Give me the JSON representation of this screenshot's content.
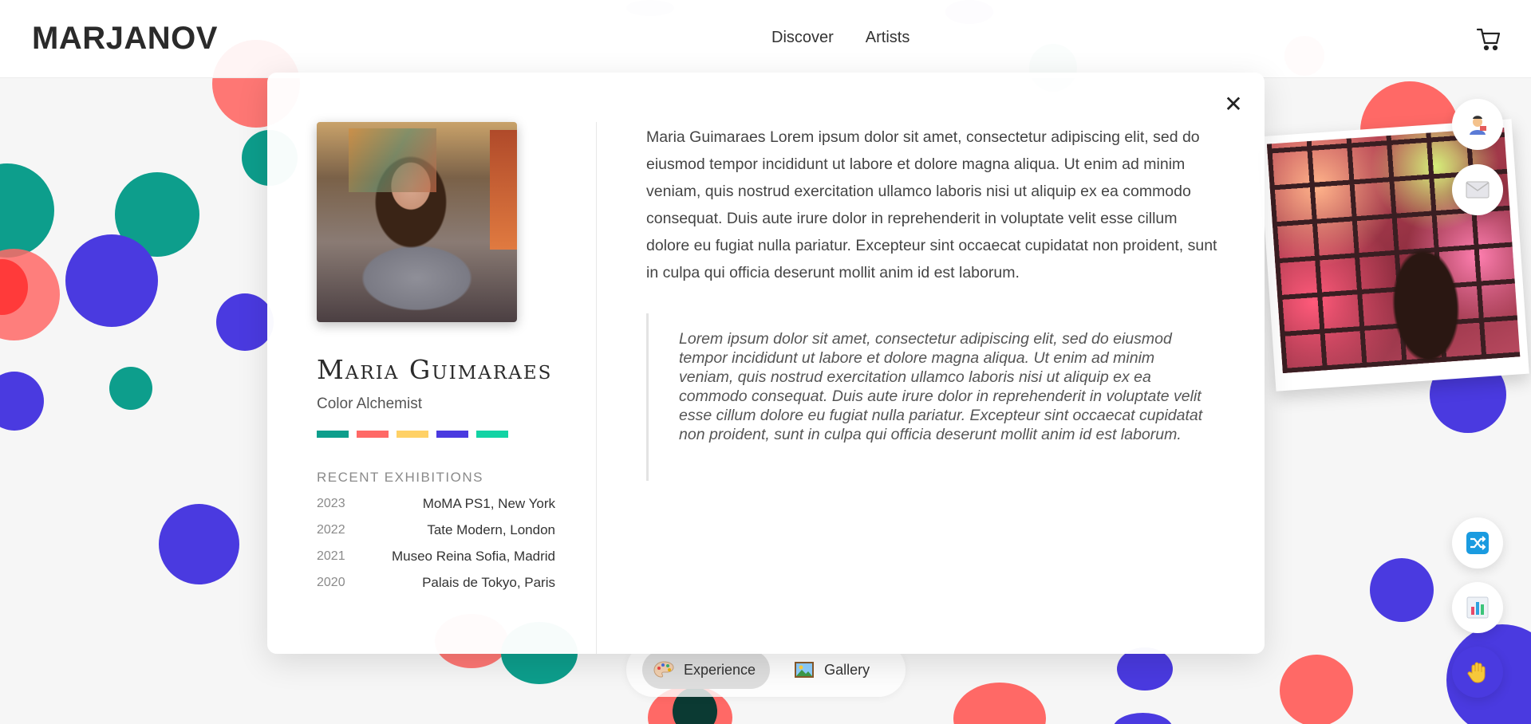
{
  "header": {
    "logo": "MARJANOV",
    "nav": [
      {
        "label": "Discover"
      },
      {
        "label": "Artists"
      }
    ],
    "cart_icon": "shopping-cart-icon"
  },
  "artist": {
    "name": "Maria Guimaraes",
    "role": "Color Alchemist",
    "palette": [
      "#0d9e8c",
      "#ff6966",
      "#ffd166",
      "#4a3ae0",
      "#12d3a4"
    ],
    "exhibitions_title": "RECENT EXHIBITIONS",
    "exhibitions": [
      {
        "year": "2023",
        "place": "MoMA PS1, New York"
      },
      {
        "year": "2022",
        "place": "Tate Modern, London"
      },
      {
        "year": "2021",
        "place": "Museo Reina Sofia, Madrid"
      },
      {
        "year": "2020",
        "place": "Palais de Tokyo, Paris"
      }
    ],
    "bio": "Maria Guimaraes Lorem ipsum dolor sit amet, consectetur adipiscing elit, sed do eiusmod tempor incididunt ut labore et dolore magna aliqua. Ut enim ad minim veniam, quis nostrud exercitation ullamco laboris nisi ut aliquip ex ea commodo consequat. Duis aute irure dolor in reprehenderit in voluptate velit esse cillum dolore eu fugiat nulla pariatur. Excepteur sint occaecat cupidatat non proident, sunt in culpa qui officia deserunt mollit anim id est laborum.",
    "quote": "Lorem ipsum dolor sit amet, consectetur adipiscing elit, sed do eiusmod tempor incididunt ut labore et dolore magna aliqua. Ut enim ad minim veniam, quis nostrud exercitation ullamco laboris nisi ut aliquip ex ea commodo consequat. Duis aute irure dolor in reprehenderit in voluptate velit esse cillum dolore eu fugiat nulla pariatur. Excepteur sint occaecat cupidatat non proident, sunt in culpa qui officia deserunt mollit anim id est laborum."
  },
  "modal": {
    "close_label": "✕"
  },
  "bottom_tabs": [
    {
      "label": "Experience",
      "icon": "palette-icon",
      "active": true
    },
    {
      "label": "Gallery",
      "icon": "picture-icon",
      "active": false
    }
  ],
  "side_buttons": [
    {
      "icon": "artist-avatar-icon"
    },
    {
      "icon": "envelope-icon"
    },
    {
      "icon": "shuffle-icon"
    },
    {
      "icon": "bar-chart-icon"
    },
    {
      "icon": "raised-hand-icon"
    }
  ],
  "colors": {
    "teal": "#0d9e8c",
    "coral": "#ff6966",
    "blue": "#4a3ae0",
    "yellow": "#ffd166",
    "mint": "#12d3a4"
  }
}
